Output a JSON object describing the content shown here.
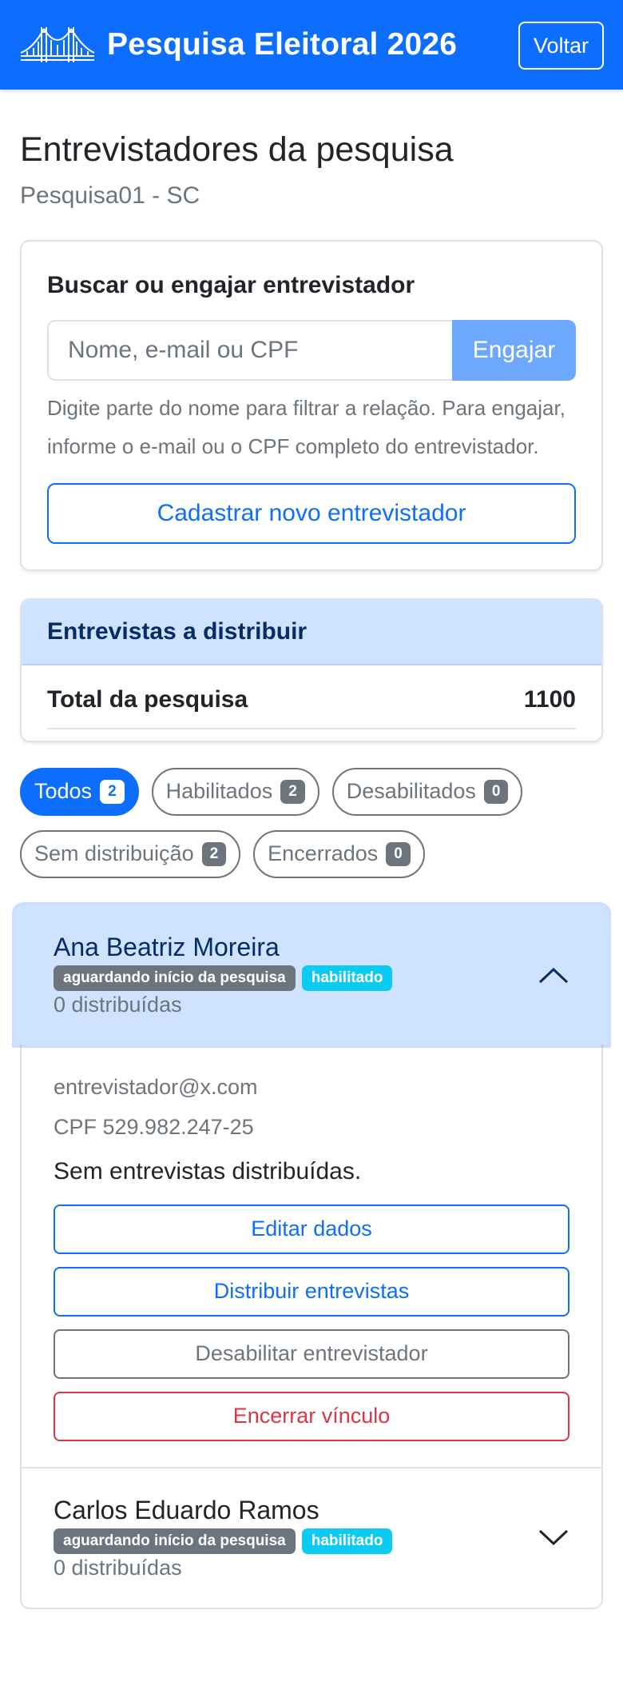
{
  "header": {
    "title": "Pesquisa Eleitoral 2026",
    "back_label": "Voltar"
  },
  "page": {
    "title": "Entrevistadores da pesquisa",
    "subtitle": "Pesquisa01 - SC"
  },
  "search": {
    "heading": "Buscar ou engajar entrevistador",
    "placeholder": "Nome, e-mail ou CPF",
    "engage_label": "Engajar",
    "help": "Digite parte do nome para filtrar a relação. Para engajar, informe o e-mail ou o CPF completo do entrevistador.",
    "register_label": "Cadastrar novo entrevistador"
  },
  "distribution": {
    "heading": "Entrevistas a distribuir",
    "total_label": "Total da pesquisa",
    "total_value": "1100"
  },
  "filters": [
    {
      "label": "Todos",
      "count": "2",
      "active": true
    },
    {
      "label": "Habilitados",
      "count": "2",
      "active": false
    },
    {
      "label": "Desabilitados",
      "count": "0",
      "active": false
    },
    {
      "label": "Sem distribuição",
      "count": "2",
      "active": false
    },
    {
      "label": "Encerrados",
      "count": "0",
      "active": false
    }
  ],
  "interviewers": [
    {
      "name": "Ana Beatriz Moreira",
      "status_badge": "aguardando início da pesquisa",
      "enabled_badge": "habilitado",
      "count": "0 distribuídas",
      "email": "entrevistador@x.com",
      "cpf": "CPF 529.982.247-25",
      "no_distribution": "Sem entrevistas distribuídas.",
      "actions": {
        "edit": "Editar dados",
        "distribute": "Distribuir entrevistas",
        "disable": "Desabilitar entrevistador",
        "end": "Encerrar vínculo"
      },
      "expanded": true
    },
    {
      "name": "Carlos Eduardo Ramos",
      "status_badge": "aguardando início da pesquisa",
      "enabled_badge": "habilitado",
      "count": "0 distribuídas",
      "expanded": false
    }
  ],
  "colors": {
    "primary": "#0d6efd",
    "info": "#0dcaf0",
    "secondary": "#6c757d",
    "danger": "#dc3545",
    "accordion_active": "#cfe2ff"
  }
}
